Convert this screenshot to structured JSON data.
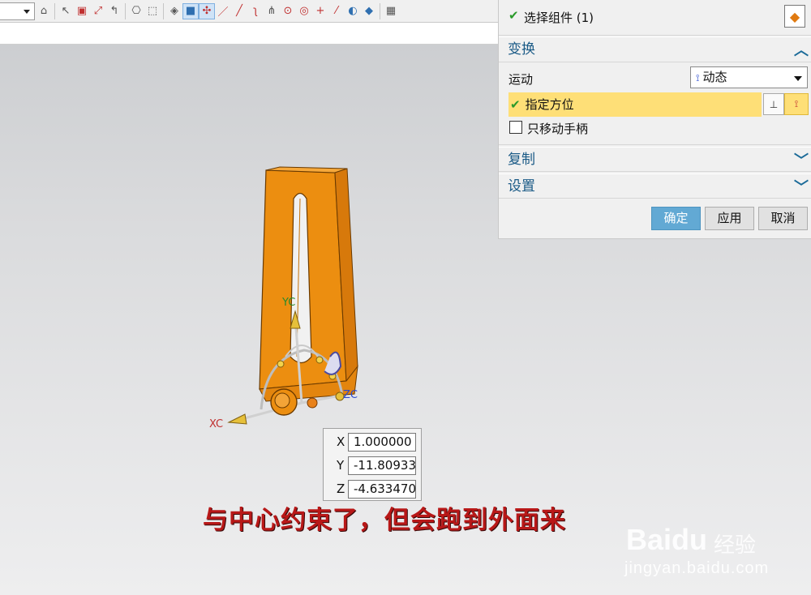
{
  "dialog": {
    "select_components_label": "选择组件 (1)",
    "transform_section_title": "变换",
    "motion_label": "运动",
    "motion_value": "动态",
    "specify_orientation_label": "指定方位",
    "move_handle_only_label": "只移动手柄",
    "copy_section_title": "复制",
    "settings_section_title": "设置",
    "ok_button": "确定",
    "apply_button": "应用",
    "cancel_button": "取消"
  },
  "coordinates": {
    "x_label": "X",
    "x_value": "1.000000",
    "y_label": "Y",
    "y_value": "-11.80933",
    "z_label": "Z",
    "z_value": "-4.633470"
  },
  "axis_labels": {
    "xc": "XC",
    "yc": "YC",
    "zc": "ZC"
  },
  "caption": "与中心约束了，但会跑到外面来",
  "watermark": {
    "brand": "Baidu",
    "brand_cn": "经验",
    "url": "jingyan.baidu.com"
  },
  "colors": {
    "part": "#ec8e10",
    "ok_button": "#62a9d4",
    "highlight": "#fedf77",
    "caption": "#b81818",
    "section_title": "#1a5a86"
  },
  "icons": [
    "dropdown-arrow-icon",
    "snap-icon",
    "select-filter-icon",
    "wireframe-icon",
    "shaded-icon",
    "point-icon",
    "line-icon",
    "arc-icon",
    "circle-icon",
    "plus-icon",
    "check-icon",
    "component-select-icon",
    "chevron-up-icon",
    "chevron-down-icon",
    "csys-icon"
  ]
}
